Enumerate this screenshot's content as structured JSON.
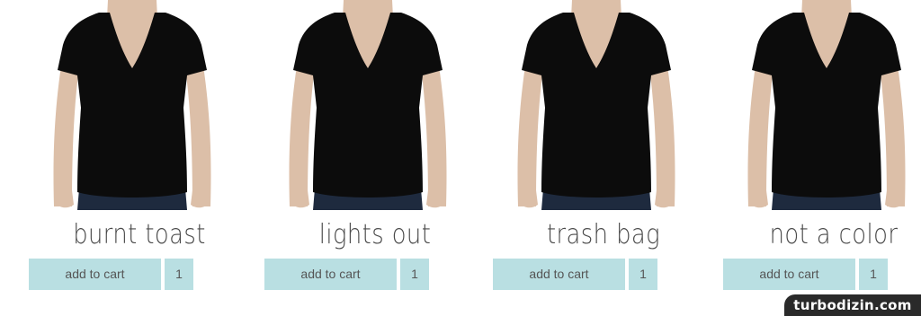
{
  "products": [
    {
      "name": "burnt toast",
      "cart_label": "add to cart",
      "quantity": "1",
      "image": "model-black-vneck-tee"
    },
    {
      "name": "lights out",
      "cart_label": "add to cart",
      "quantity": "1",
      "image": "model-black-vneck-tee"
    },
    {
      "name": "trash bag",
      "cart_label": "add to cart",
      "quantity": "1",
      "image": "model-black-vneck-tee"
    },
    {
      "name": "not a color",
      "cart_label": "add to cart",
      "quantity": "1",
      "image": "model-black-vneck-tee"
    }
  ],
  "watermark": "turbodizin.com",
  "colors": {
    "button_bg": "#b9dfe2",
    "name_text": "#4a4a4a",
    "shirt": "#0c0c0c",
    "skin": "#dcbfa8",
    "jeans": "#1e2a3e"
  }
}
